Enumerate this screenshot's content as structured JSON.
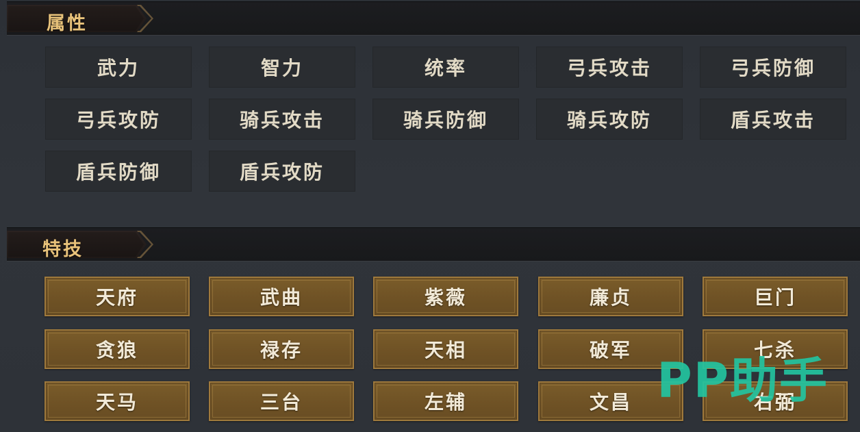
{
  "attributes": {
    "title": "属性",
    "items": [
      "武力",
      "智力",
      "统率",
      "弓兵攻击",
      "弓兵防御",
      "弓兵攻防",
      "骑兵攻击",
      "骑兵防御",
      "骑兵攻防",
      "盾兵攻击",
      "盾兵防御",
      "盾兵攻防"
    ]
  },
  "skills": {
    "title": "特技",
    "items": [
      "天府",
      "武曲",
      "紫薇",
      "廉贞",
      "巨门",
      "贪狼",
      "禄存",
      "天相",
      "破军",
      "七杀",
      "天马",
      "三台",
      "左辅",
      "文昌",
      "右弼"
    ]
  },
  "watermark": "PP助手",
  "colors": {
    "header_text": "#e8c27a",
    "skill_fill": "#6f5225",
    "skill_border": "#a07a3c",
    "attr_fill": "#2a2d31",
    "watermark": "#23c4a0"
  }
}
